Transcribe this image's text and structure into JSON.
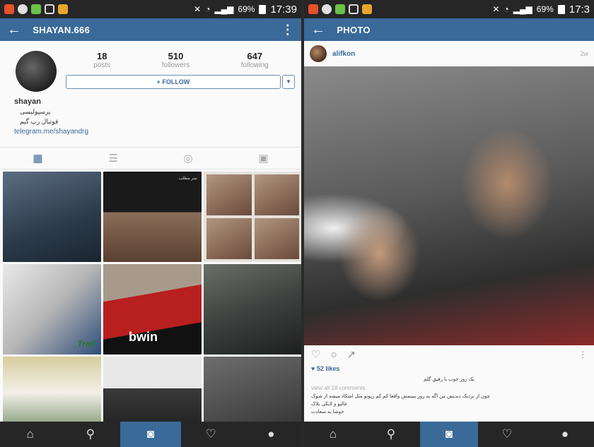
{
  "left": {
    "status": {
      "battery": "69%",
      "time": "17:39"
    },
    "appbar": {
      "title": "SHAYAN.666"
    },
    "profile": {
      "stats": [
        {
          "value": "18",
          "label": "posts"
        },
        {
          "value": "510",
          "label": "followers"
        },
        {
          "value": "647",
          "label": "following"
        }
      ],
      "follow_label": "+ FOLLOW",
      "name": "shayan",
      "bio_lines": [
        "پرسپولیسی",
        "فوتبال رپ گیم"
      ],
      "link": "telegram.me/shayandrg"
    },
    "grid_texts": {
      "c4": "Troll",
      "c5": "bwin"
    },
    "bottomnav": [
      "home-icon",
      "search-icon",
      "camera-icon",
      "heart-icon",
      "profile-icon"
    ]
  },
  "right": {
    "status": {
      "battery": "69%",
      "time": "17:3"
    },
    "appbar": {
      "title": "PHOTO"
    },
    "post": {
      "user": "alifkon",
      "time": "2w",
      "likes": "♥ 52 likes",
      "caption": "یک روز خوب با رفیق گلم",
      "comments_link": "view all 18 comments",
      "comments": [
        "چون از نزدیک دیدیش من اگه یه روز ببینمش واقعا کم کم ریوتو مثل اشکاد میشه از شوک",
        "عالیو و لایکی بلاک",
        "خوشا به سعادت"
      ]
    },
    "bottomnav": [
      "home-icon",
      "search-icon",
      "camera-icon",
      "heart-icon",
      "profile-icon"
    ]
  }
}
